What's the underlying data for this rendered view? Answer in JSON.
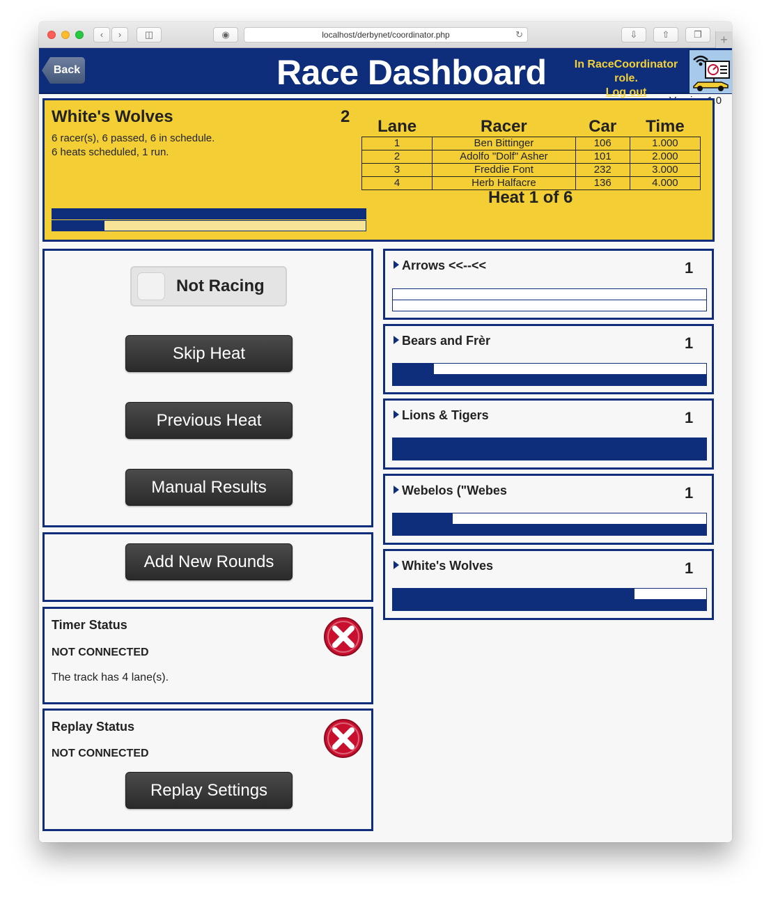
{
  "browser": {
    "url_host": "localhost",
    "url_path": "/derbynet/coordinator.php"
  },
  "banner": {
    "back_label": "Back",
    "title": "Race Dashboard",
    "role_text": "In RaceCoordinator role.",
    "logout_label": "Log out",
    "version": "Version 1.0"
  },
  "current_heat": {
    "round_name": "White's Wolves",
    "round_number": "2",
    "summary_line1": "6 racer(s), 6 passed, 6 in schedule.",
    "summary_line2": "6 heats scheduled, 1 run.",
    "progress_top": 1.0,
    "progress_bottom": 0.167,
    "columns": [
      "Lane",
      "Racer",
      "Car",
      "Time"
    ],
    "rows": [
      {
        "lane": "1",
        "racer": "Ben Bittinger",
        "car": "106",
        "time": "1.000"
      },
      {
        "lane": "2",
        "racer": "Adolfo \"Dolf\" Asher",
        "car": "101",
        "time": "2.000"
      },
      {
        "lane": "3",
        "racer": "Freddie Font",
        "car": "232",
        "time": "3.000"
      },
      {
        "lane": "4",
        "racer": "Herb Halfacre",
        "car": "136",
        "time": "4.000"
      }
    ],
    "heat_label": "Heat 1 of 6"
  },
  "controls": {
    "racing_toggle_label": "Not Racing",
    "skip_heat": "Skip Heat",
    "previous_heat": "Previous Heat",
    "manual_results": "Manual Results",
    "add_new_rounds": "Add New Rounds"
  },
  "timer_status": {
    "title": "Timer Status",
    "state": "NOT CONNECTED",
    "detail": "The track has 4 lane(s).",
    "icon": "error-x-icon"
  },
  "replay_status": {
    "title": "Replay Status",
    "state": "NOT CONNECTED",
    "settings_button": "Replay Settings",
    "icon": "error-x-icon"
  },
  "rounds": [
    {
      "name": "Arrows <<--<<",
      "round": "1",
      "progress_top": 0.0,
      "progress_bottom": 0.0
    },
    {
      "name": "Bears and Frèr",
      "round": "1",
      "progress_top": 0.13,
      "progress_bottom": 1.0
    },
    {
      "name": "Lions & Tigers",
      "round": "1",
      "progress_top": 1.0,
      "progress_bottom": 1.0
    },
    {
      "name": "Webelos (\"Webes",
      "round": "1",
      "progress_top": 0.19,
      "progress_bottom": 1.0
    },
    {
      "name": "White's Wolves",
      "round": "1",
      "progress_top": 0.77,
      "progress_bottom": 1.0
    }
  ],
  "colors": {
    "navy": "#0e2d7a",
    "gold": "#f3cf35",
    "error_red": "#c8102e"
  }
}
